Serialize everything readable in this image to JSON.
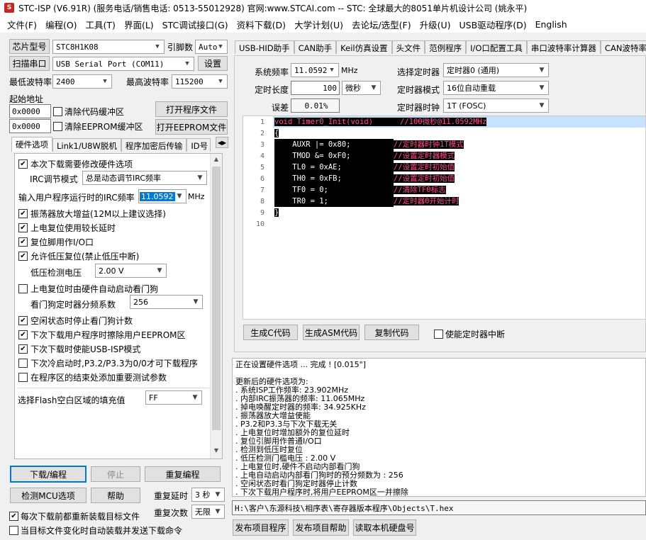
{
  "window": {
    "title": "STC-ISP (V6.91R) (服务电话/销售电话: 0513-55012928) 官网:www.STCAI.com  -- STC: 全球最大的8051单片机设计公司 (姚永平)"
  },
  "menu": [
    "文件(F)",
    "编程(O)",
    "工具(T)",
    "界面(L)",
    "STC调试接口(G)",
    "资料下载(D)",
    "大学计划(U)",
    "去论坛/选型(F)",
    "升级(U)",
    "USB驱动程序(D)",
    "English"
  ],
  "left": {
    "chip_label": "芯片型号",
    "chip_value": "STC8H1K08",
    "pins_label": "引脚数",
    "pins_value": "Auto",
    "scan_label": "扫描串口",
    "port_value": "USB Serial Port (COM11)",
    "settings_label": "设置",
    "min_baud_label": "最低波特率",
    "min_baud_value": "2400",
    "max_baud_label": "最高波特率",
    "max_baud_value": "115200",
    "start_addr_label": "起始地址",
    "addr1": "0x0000",
    "clear_code_label": "清除代码缓冲区",
    "open_prog": "打开程序文件",
    "addr2": "0x0000",
    "clear_eeprom_label": "清除EEPROM缓冲区",
    "open_eeprom": "打开EEPROM文件",
    "tabs": [
      "硬件选项",
      "Link1/U8W脱机",
      "程序加密后传输",
      "ID号"
    ]
  },
  "hw": {
    "need_modify": "本次下载需要修改硬件选项",
    "irc_mode_label": "IRC调节模式",
    "irc_mode_value": "总是动态调节IRC频率",
    "irc_freq_label": "输入用户程序运行时的IRC频率",
    "irc_freq_value": "11.0592",
    "irc_unit": "MHz",
    "osc_gain": "振荡器放大增益(12M以上建议选择)",
    "long_reset": "上电复位使用较长延时",
    "reset_io": "复位脚用作I/O口",
    "lvr": "允许低压复位(禁止低压中断)",
    "lvd_label": "低压检测电压",
    "lvd_value": "2.00 V",
    "wdt_hw": "上电复位时由硬件自动启动看门狗",
    "wdt_div_label": "看门狗定时器分频系数",
    "wdt_div_value": "256",
    "idle_wdt": "空闲状态时停止看门狗计数",
    "erase_eeprom": "下次下载用户程序时擦除用户EEPROM区",
    "usb_isp": "下次下载时使能USB-ISP模式",
    "p32": "下次冷启动时,P3.2/P3.3为0/0才可下载程序",
    "add_param": "在程序区的结束处添加重要测试参数",
    "fill_label": "选择Flash空白区域的填充值",
    "fill_value": "FF"
  },
  "bottom_left": {
    "download": "下载/编程",
    "stop": "停止",
    "reprog": "重复编程",
    "detect": "检测MCU选项",
    "help": "帮助",
    "repeat_delay_label": "重复延时",
    "repeat_delay_value": "3 秒",
    "repeat_count_label": "重复次数",
    "repeat_count_value": "无限",
    "reload": "每次下载前都重新装载目标文件",
    "auto_send": "当目标文件变化时自动装载并发送下载命令"
  },
  "right": {
    "tabs": [
      "USB-HID助手",
      "CAN助手",
      "Keil仿真设置",
      "头文件",
      "范例程序",
      "I/O口配置工具",
      "串口波特率计算器",
      "CAN波特率"
    ],
    "sys_freq_label": "系统频率",
    "sys_freq_value": "11.0592",
    "sys_freq_unit": "MHz",
    "timer_len_label": "定时长度",
    "timer_len_value": "100",
    "timer_len_unit": "微秒",
    "error_label": "误差",
    "error_value": "0.01%",
    "sel_timer_label": "选择定时器",
    "sel_timer_value": "定时器0 (通用)",
    "timer_mode_label": "定时器模式",
    "timer_mode_value": "16位自动重载",
    "timer_clk_label": "定时器时钟",
    "timer_clk_value": "1T  (FOSC)",
    "gen_c": "生成C代码",
    "gen_asm": "生成ASM代码",
    "copy": "复制代码",
    "enable_int": "使能定时器中断"
  },
  "code": {
    "line_numbers": [
      "1",
      "2",
      "3",
      "4",
      "5",
      "6",
      "7",
      "8",
      "9",
      "10"
    ],
    "l1": "void Timer0_Init(void)",
    "l1c": "//100微秒@11.0592MHz",
    "l2": "{",
    "l3": "    AUXR |= 0x80;",
    "l3c": "//定时器时钟1T模式",
    "l4": "    TMOD &= 0xF0;",
    "l4c": "//设置定时器模式",
    "l5": "    TL0 = 0xAE;",
    "l5c": "//设置定时初始值",
    "l6": "    TH0 = 0xFB;",
    "l6c": "//设置定时初始值",
    "l7": "    TF0 = 0;",
    "l7c": "//清除TF0标志",
    "l8": "    TR0 = 1;",
    "l8c": "//定时器0开始计时",
    "l9": "}",
    "l10": ""
  },
  "log": {
    "lines": [
      "正在设置硬件选项 ... 完成 !            [0.015\"]",
      "",
      "更新后的硬件选项为:",
      "  . 系统ISP工作频率: 23.902MHz",
      "  . 内部IRC振荡器的频率: 11.065MHz",
      "  . 掉电唤醒定时器的频率: 34.925KHz",
      "  . 振荡器放大增益使能",
      "  . P3.2和P3.3与下次下载无关",
      "  . 上电复位时增加额外的复位延时",
      "  . 复位引脚用作普通I/O口",
      "  . 检测到低压时复位",
      "  . 低压检测门槛电压 : 2.00 V",
      "  . 上电复位时,硬件不启动内部看门狗",
      "  . 上电自动启动内部看门狗时的预分频数为 : 256",
      "  . 空闲状态时看门狗定时器停止计数",
      "  . 下次下载用户程序时,将用户EEPROM区一并擦除"
    ],
    "path": "H:\\客户\\东源科技\\相序表\\寄存器版本程序\\Objects\\T.hex",
    "publish": "发布项目程序",
    "publish_help": "发布项目帮助",
    "read_disk": "读取本机硬盘号"
  }
}
